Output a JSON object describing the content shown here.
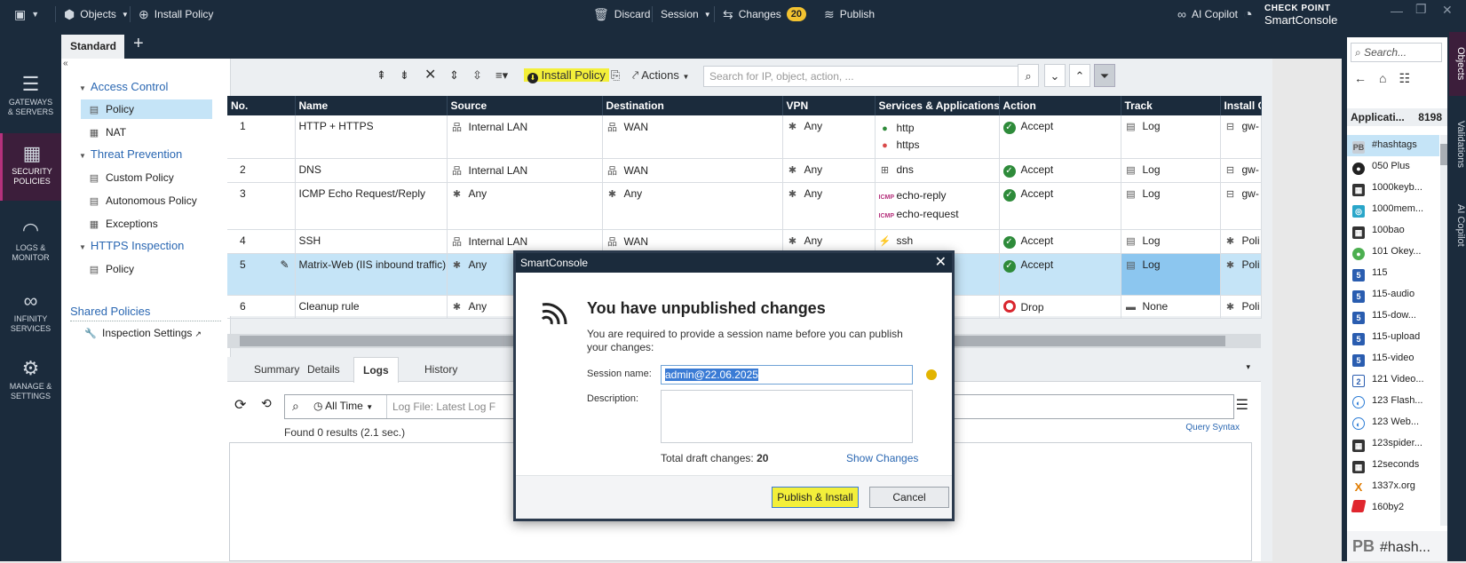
{
  "topbar": {
    "objects": "Objects",
    "install_policy": "Install Policy",
    "discard": "Discard",
    "session": "Session",
    "changes": "Changes",
    "changes_count": "20",
    "publish": "Publish",
    "ai_copilot": "AI Copilot",
    "brand_top": "CHECK POINT",
    "brand_bottom": "SmartConsole"
  },
  "leftnav": [
    {
      "label1": "GATEWAYS",
      "label2": "& SERVERS"
    },
    {
      "label1": "SECURITY",
      "label2": "POLICIES"
    },
    {
      "label1": "LOGS &",
      "label2": "MONITOR"
    },
    {
      "label1": "INFINITY",
      "label2": "SERVICES"
    },
    {
      "label1": "MANAGE &",
      "label2": "SETTINGS"
    }
  ],
  "tabs": {
    "standard": "Standard"
  },
  "tree": {
    "access_control": "Access Control",
    "policy": "Policy",
    "nat": "NAT",
    "threat_prevention": "Threat Prevention",
    "custom_policy": "Custom Policy",
    "autonomous_policy": "Autonomous Policy",
    "exceptions": "Exceptions",
    "https_inspection": "HTTPS Inspection",
    "https_policy": "Policy",
    "shared_policies": "Shared Policies",
    "inspection_settings": "Inspection Settings"
  },
  "toolbar": {
    "install_policy": "Install Policy",
    "actions": "Actions",
    "search_placeholder": "Search for IP, object, action, ..."
  },
  "table": {
    "headers": [
      "No.",
      "Name",
      "Source",
      "Destination",
      "VPN",
      "Services & Applications",
      "Action",
      "Track",
      "Install O"
    ],
    "rows": [
      {
        "no": "1",
        "name": "HTTP + HTTPS",
        "source": "Internal LAN",
        "dest": "WAN",
        "vpn": "Any",
        "svc1": "http",
        "svc2": "https",
        "action": "Accept",
        "track": "Log",
        "install": "gw-"
      },
      {
        "no": "2",
        "name": "DNS",
        "source": "Internal LAN",
        "dest": "WAN",
        "vpn": "Any",
        "svc1": "dns",
        "svc2": "",
        "action": "Accept",
        "track": "Log",
        "install": "gw-"
      },
      {
        "no": "3",
        "name": "ICMP Echo Request/Reply",
        "source": "Any",
        "dest": "Any",
        "vpn": "Any",
        "svc1": "echo-reply",
        "svc2": "echo-request",
        "action": "Accept",
        "track": "Log",
        "install": "gw-"
      },
      {
        "no": "4",
        "name": "SSH",
        "source": "Internal LAN",
        "dest": "WAN",
        "vpn": "Any",
        "svc1": "ssh",
        "svc2": "",
        "action": "Accept",
        "track": "Log",
        "install": "Poli"
      },
      {
        "no": "5",
        "name": "Matrix-Web (IIS inbound traffic)",
        "source": "Any",
        "dest": "",
        "vpn": "",
        "svc1": "ttp",
        "svc2": "ttps",
        "action": "Accept",
        "track": "Log",
        "install": "Poli"
      },
      {
        "no": "6",
        "name": "Cleanup rule",
        "source": "Any",
        "dest": "",
        "vpn": "",
        "svc1": "ny",
        "svc2": "",
        "action": "Drop",
        "track": "None",
        "install": "Poli"
      }
    ]
  },
  "lower": {
    "tabs": [
      "Summary",
      "Details",
      "Logs",
      "History"
    ],
    "all_time": "All Time",
    "log_placeholder": "Log File: Latest Log F",
    "found": "Found 0 results (2.1 sec.)",
    "query_syntax": "Query Syntax"
  },
  "rightpanel": {
    "search": "Search...",
    "header": "Applicati...",
    "count": "8198",
    "items": [
      "#hashtags",
      "050 Plus",
      "1000keyb...",
      "1000mem...",
      "100bao",
      "101 Okey...",
      "115",
      "115-audio",
      "115-dow...",
      "115-upload",
      "115-video",
      "121 Video...",
      "123 Flash...",
      "123 Web...",
      "123spider...",
      "12seconds",
      "1337x.org",
      "160by2"
    ],
    "footer": "#hash...",
    "footer_ic": "PB",
    "vtabs": [
      "Objects",
      "Validations",
      "AI Copilot"
    ]
  },
  "dialog": {
    "title": "SmartConsole",
    "heading": "You have unpublished changes",
    "text": "You are required to provide a session name before you can publish your changes:",
    "session_label": "Session name:",
    "session_value": "admin@22.06.2025",
    "description_label": "Description:",
    "total_label": "Total draft changes:",
    "total_value": "20",
    "show_changes": "Show Changes",
    "publish_install": "Publish & Install",
    "cancel": "Cancel"
  }
}
